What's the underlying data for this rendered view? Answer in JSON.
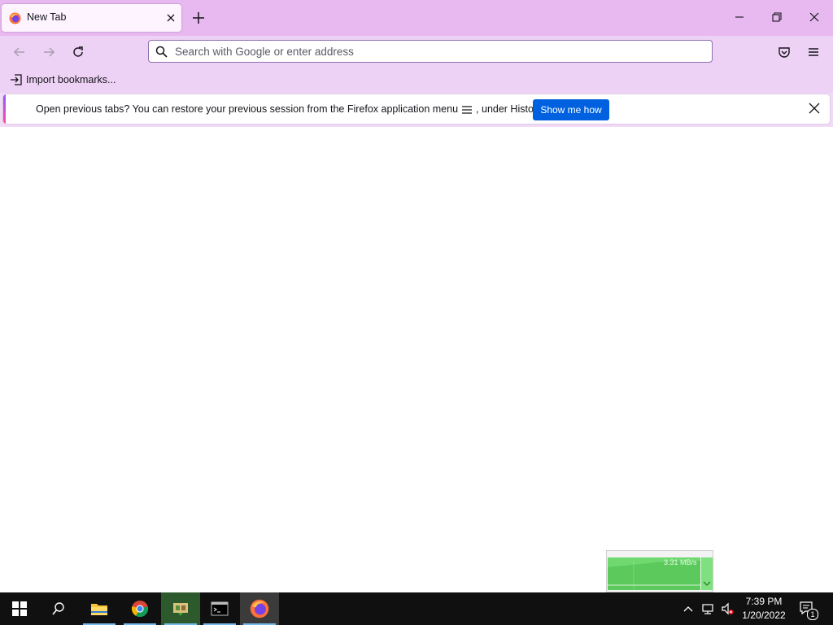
{
  "browser": {
    "tab": {
      "title": "New Tab"
    },
    "urlbar": {
      "placeholder": "Search with Google or enter address"
    },
    "bookmarks": {
      "import_label": "Import bookmarks..."
    },
    "notification": {
      "text_before": "Open previous tabs? You can restore your previous session from the Firefox application menu",
      "text_after": ", under History.",
      "button_label": "Show me how"
    }
  },
  "network_widget": {
    "rate": "3.31 MB/s"
  },
  "taskbar": {
    "apps": [
      "start-icon",
      "search-icon",
      "file-explorer-icon",
      "chrome-icon",
      "app-icon",
      "terminal-icon",
      "firefox-icon"
    ],
    "clock": {
      "time": "7:39 PM",
      "date": "1/20/2022"
    },
    "notification_count": "1"
  },
  "colors": {
    "titlebar": "#e8b8f0",
    "toolbar": "#eed2f5",
    "accent_button": "#0061e0"
  }
}
